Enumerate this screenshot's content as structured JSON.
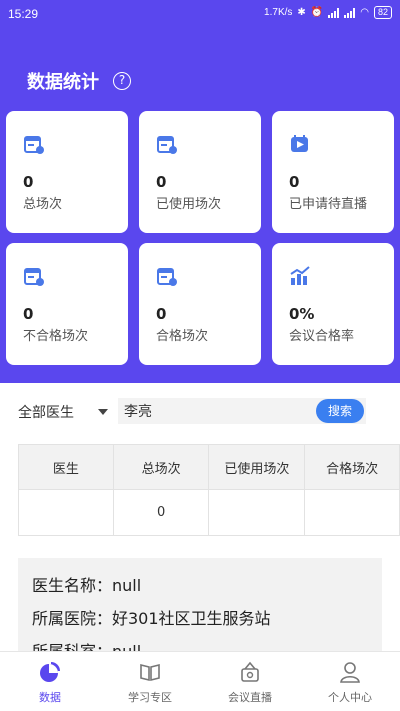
{
  "status_bar": {
    "time": "15:29",
    "network_speed": "1.7K/s",
    "battery": "82"
  },
  "header": {
    "title": "数据统计",
    "help_icon": "?"
  },
  "stats": [
    {
      "icon": "calendar-stats-icon",
      "value": "0",
      "label": "总场次"
    },
    {
      "icon": "calendar-check-icon",
      "value": "0",
      "label": "已使用场次"
    },
    {
      "icon": "video-play-icon",
      "value": "0",
      "label": "已申请待直播"
    },
    {
      "icon": "calendar-fail-icon",
      "value": "0",
      "label": "不合格场次"
    },
    {
      "icon": "calendar-pass-icon",
      "value": "0",
      "label": "合格场次"
    },
    {
      "icon": "bar-chart-icon",
      "value": "0%",
      "label": "会议合格率"
    }
  ],
  "filter": {
    "doctor_select": "全部医生",
    "search_value": "李亮",
    "search_button": "搜索"
  },
  "table": {
    "headers": [
      "医生",
      "总场次",
      "已使用场次",
      "合格场次"
    ],
    "rows": [
      [
        "",
        "0",
        "",
        ""
      ]
    ]
  },
  "info": {
    "doctor_name": "医生名称：null",
    "hospital": "所属医院：好301社区卫生服务站",
    "department": "所属科室：null"
  },
  "tabbar": [
    {
      "label": "数据",
      "icon": "pie-chart-icon",
      "active": true
    },
    {
      "label": "学习专区",
      "icon": "book-icon",
      "active": false
    },
    {
      "label": "会议直播",
      "icon": "live-meeting-icon",
      "active": false
    },
    {
      "label": "个人中心",
      "icon": "user-icon",
      "active": false
    }
  ],
  "colors": {
    "primary": "#5a47ee",
    "accent_blue": "#3a7ff0",
    "icon_blue": "#4a78e8"
  }
}
